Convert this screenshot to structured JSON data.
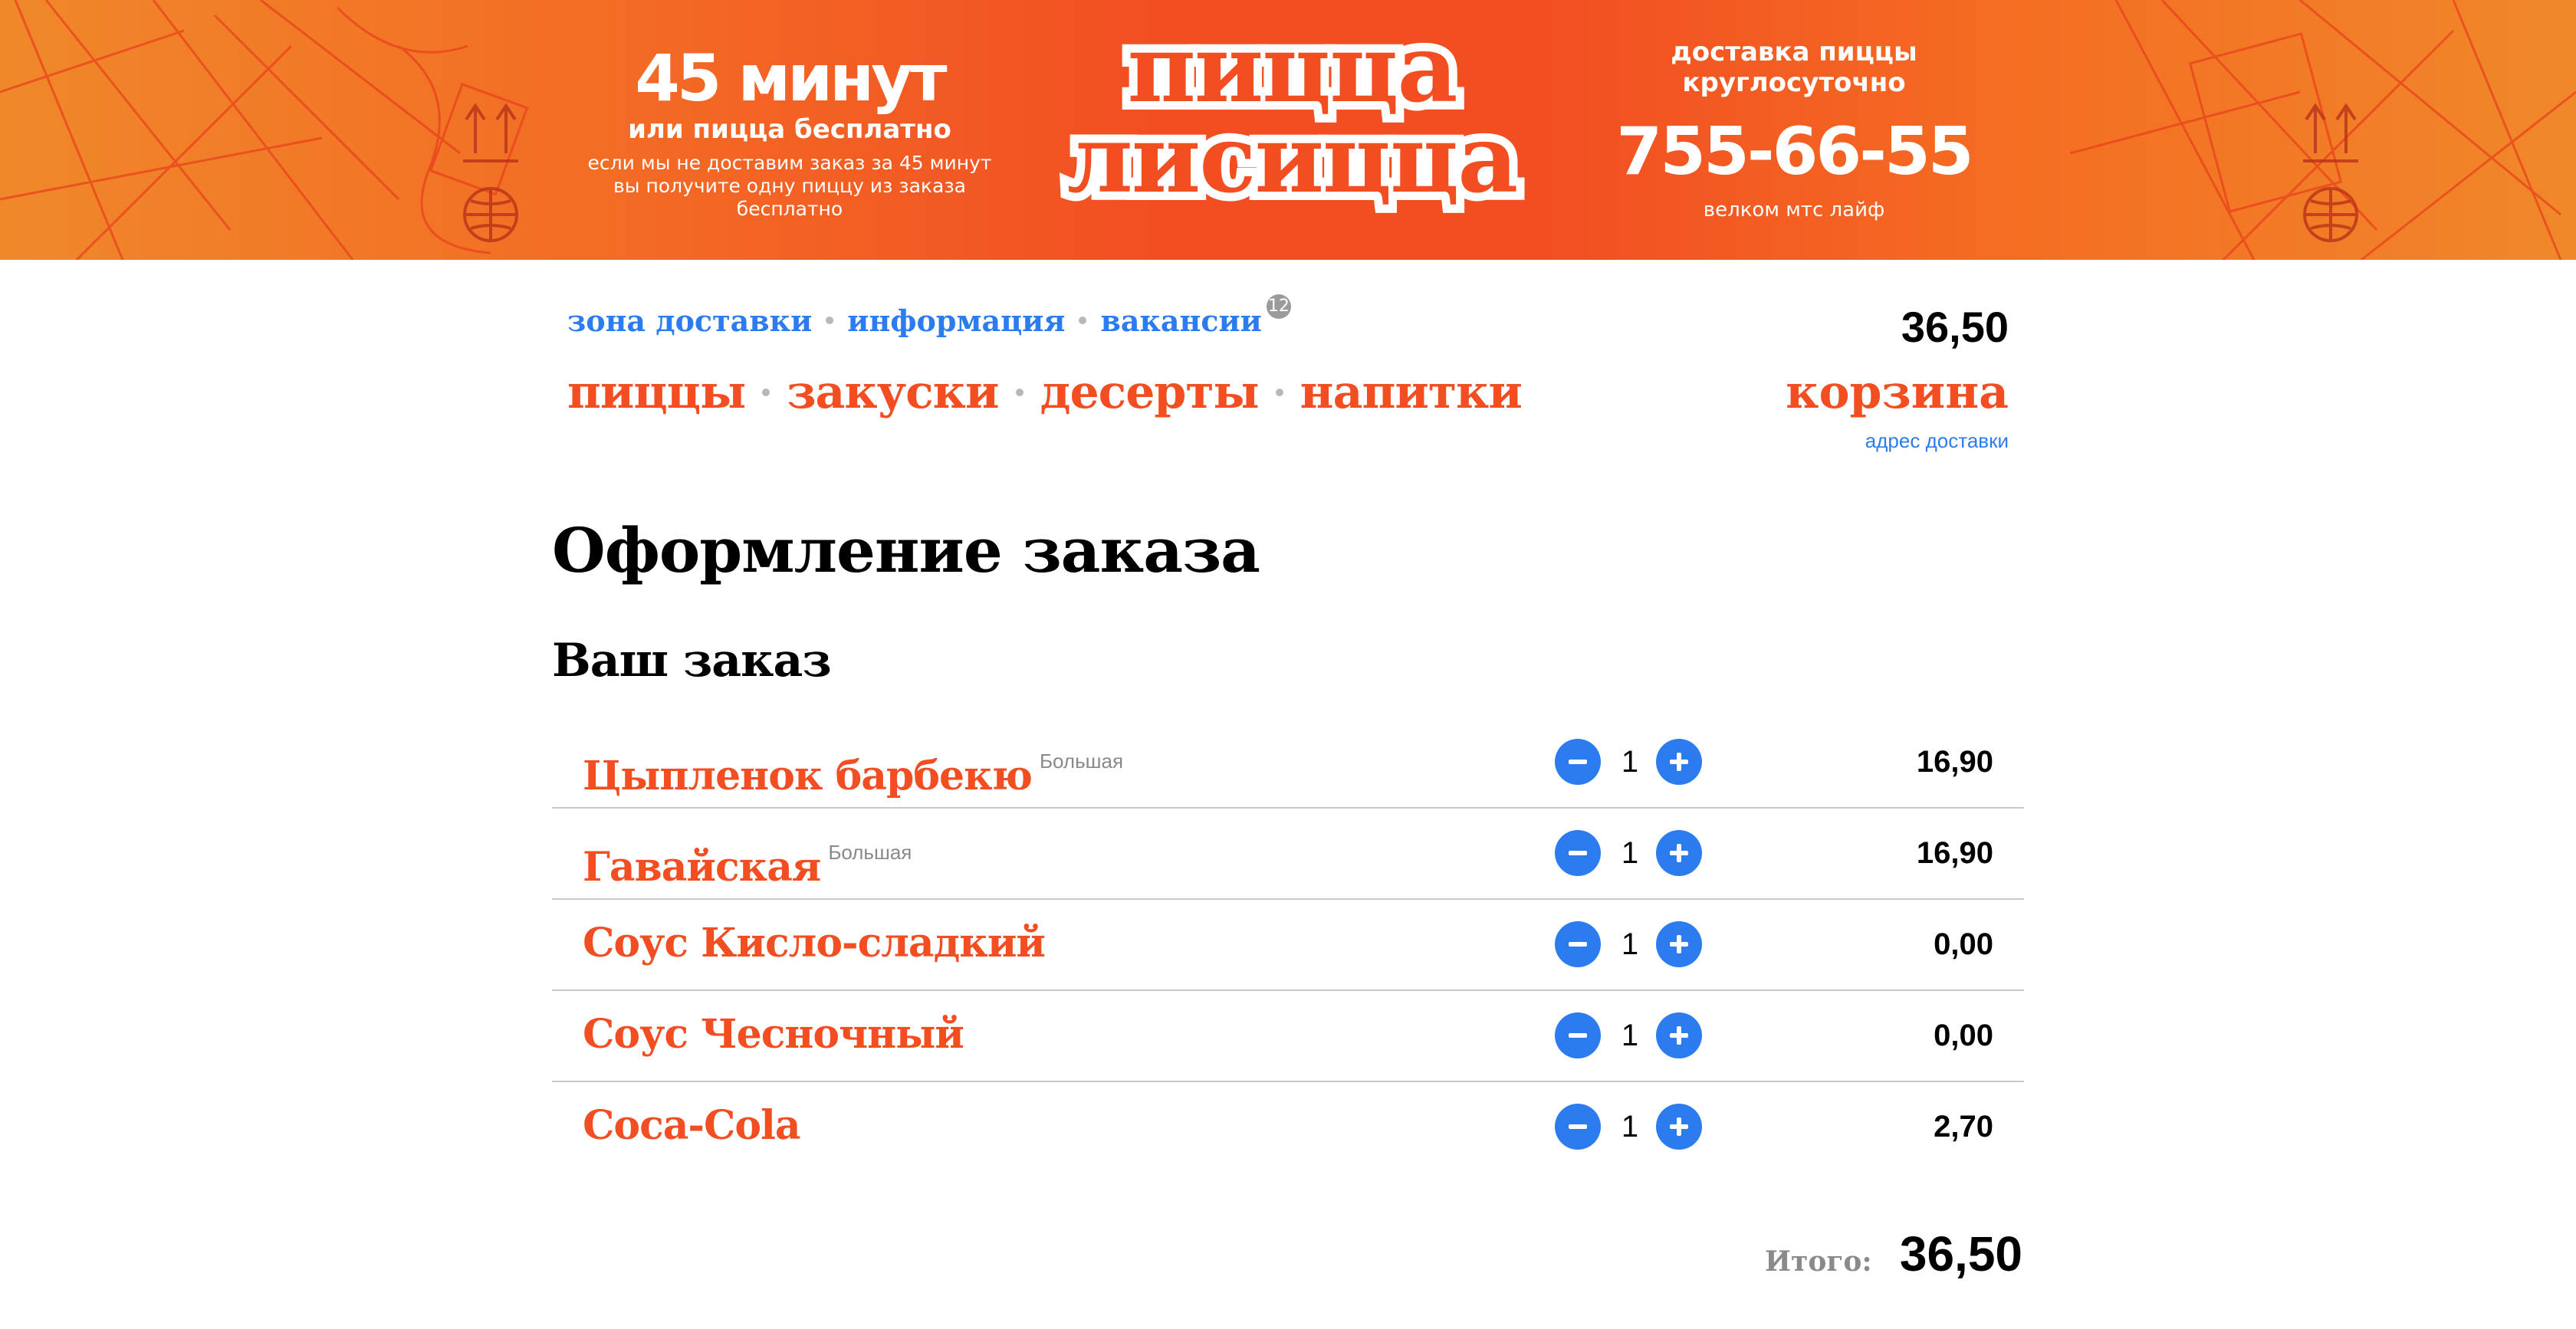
{
  "banner": {
    "promo_big": "45 минут",
    "promo_sub": "или пицца бесплатно",
    "promo_small": "если мы не доставим заказ за 45 минут вы получите одну пиццу из заказа бесплатно",
    "logo_line1": "пицца",
    "logo_line2": "лисицца",
    "delivery_label": "доставка пиццы круглосуточно",
    "phone": "755-66-55",
    "operator": "велком мтс лайф",
    "colors": {
      "orange": "#f0882a",
      "red_orange": "#f24e22"
    }
  },
  "nav": {
    "secondary": [
      {
        "label": "зона доставки"
      },
      {
        "label": "информация"
      },
      {
        "label": "вакансии",
        "badge": "12"
      }
    ],
    "primary": [
      {
        "label": "пиццы"
      },
      {
        "label": "закуски"
      },
      {
        "label": "десерты"
      },
      {
        "label": "напитки"
      }
    ],
    "cart_total": "36,50",
    "cart_label": "корзина",
    "address_link": "адрес доставки"
  },
  "order": {
    "title": "Оформление заказа",
    "subtitle": "Ваш заказ",
    "items": [
      {
        "name": "Цыпленок барбекю",
        "size": "Большая",
        "qty": "1",
        "price": "16,90"
      },
      {
        "name": "Гавайская",
        "size": "Большая",
        "qty": "1",
        "price": "16,90"
      },
      {
        "name": "Соус Кисло-сладкий",
        "size": "",
        "qty": "1",
        "price": "0,00"
      },
      {
        "name": "Соус Чесночный",
        "size": "",
        "qty": "1",
        "price": "0,00"
      },
      {
        "name": "Coca-Cola",
        "size": "",
        "qty": "1",
        "price": "2,70"
      }
    ],
    "total_label": "Итого:",
    "total_value": "36,50"
  },
  "icons": {
    "decrement": "minus-icon",
    "increment": "plus-icon"
  },
  "accent_color": "#2c7cf0"
}
